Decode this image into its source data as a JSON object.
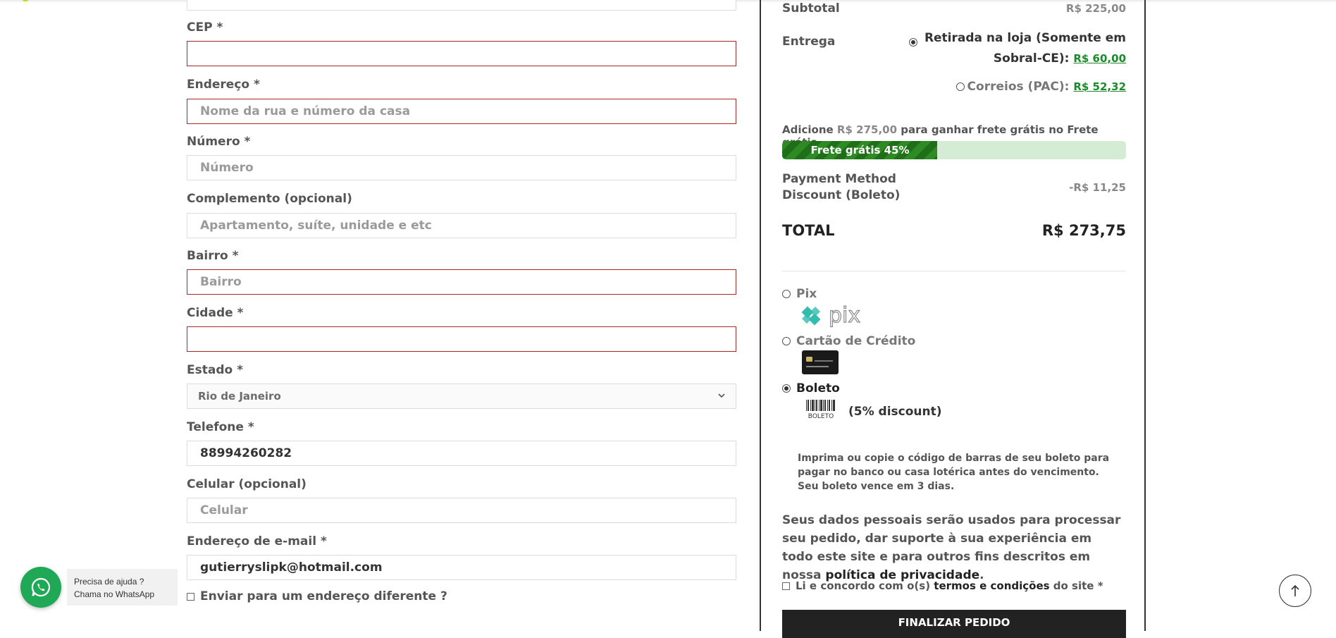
{
  "form": {
    "fields": [
      {
        "label": "CEP *",
        "value": "",
        "placeholder": ""
      },
      {
        "label": "Endereço *",
        "value": "",
        "placeholder": "Nome da rua e número da casa"
      },
      {
        "label": "Número *",
        "value": "",
        "placeholder": "Número"
      },
      {
        "label": "Complemento (opcional)",
        "value": "",
        "placeholder": "Apartamento, suíte, unidade e etc"
      },
      {
        "label": "Bairro *",
        "value": "",
        "placeholder": "Bairro"
      },
      {
        "label": "Cidade *",
        "value": "",
        "placeholder": ""
      },
      {
        "label": "Estado *",
        "selected": "Rio de Janeiro"
      },
      {
        "label": "Telefone *",
        "value": "88994260282",
        "placeholder": ""
      },
      {
        "label": "Celular (opcional)",
        "value": "",
        "placeholder": "Celular"
      },
      {
        "label": "Endereço de e-mail *",
        "value": "gutierryslipk@hotmail.com",
        "placeholder": ""
      }
    ],
    "ship_different_label": "Enviar para um endereço diferente ?"
  },
  "summary": {
    "subtotal_label": "Subtotal",
    "subtotal_value": "R$ 225,00",
    "shipping_label": "Entrega",
    "shipping_options": [
      {
        "line1": "Retirada na loja (Somente em",
        "line2": "Sobral-CE):",
        "price": "R$ 60,00",
        "selected": true
      },
      {
        "label": "Correios (PAC):",
        "price": "R$ 52,32",
        "selected": false
      }
    ],
    "free_shipping": {
      "prefix": "Adicione",
      "amount": "R$ 275,00",
      "suffix": "para ganhar frete grátis no Frete grátis",
      "bar_text": "Frete grátis 45%",
      "progress": 0.45
    },
    "discount_label": "Payment Method Discount (Boleto)",
    "discount_value": "-R$ 11,25",
    "total_label": "TOTAL",
    "total_value": "R$ 273,75"
  },
  "payment": {
    "options": [
      {
        "label": "Pix",
        "selected": false
      },
      {
        "label": "Cartão de Crédito",
        "selected": false
      },
      {
        "label": "Boleto",
        "selected": true
      }
    ],
    "pix_logo_text": "pix",
    "boleto_logo_text": "BOLETO",
    "boleto_discount": "(5% discount)",
    "boleto_desc_1": "Imprima ou copie o código de barras de seu boleto para pagar no banco ou casa lotérica antes do vencimento.",
    "boleto_desc_2": "Seu boleto vence em 3 dias."
  },
  "privacy": {
    "text": "Seus dados pessoais serão usados para processar seu pedido, dar suporte à sua experiência em todo este site e para outros fins descritos em nossa",
    "link": "política de privacidade",
    "end": "."
  },
  "terms": {
    "prefix": "Li e concordo com o(s)",
    "link": "termos e condições",
    "suffix": "do site *"
  },
  "place_order_label": "FINALIZAR PEDIDO",
  "whatsapp": {
    "line1": "Precisa de ajuda ?",
    "line2": "Chama no WhatsApp",
    "color": "#1fa855"
  },
  "colors": {
    "error_border": "#a12a2a",
    "progress_green": "#2e8b23",
    "price_link_green": "#1a8a2a"
  },
  "icons": {
    "select": "chevron-down-icon",
    "whatsapp": "whatsapp-icon",
    "scroll_top": "arrow-up-icon"
  }
}
